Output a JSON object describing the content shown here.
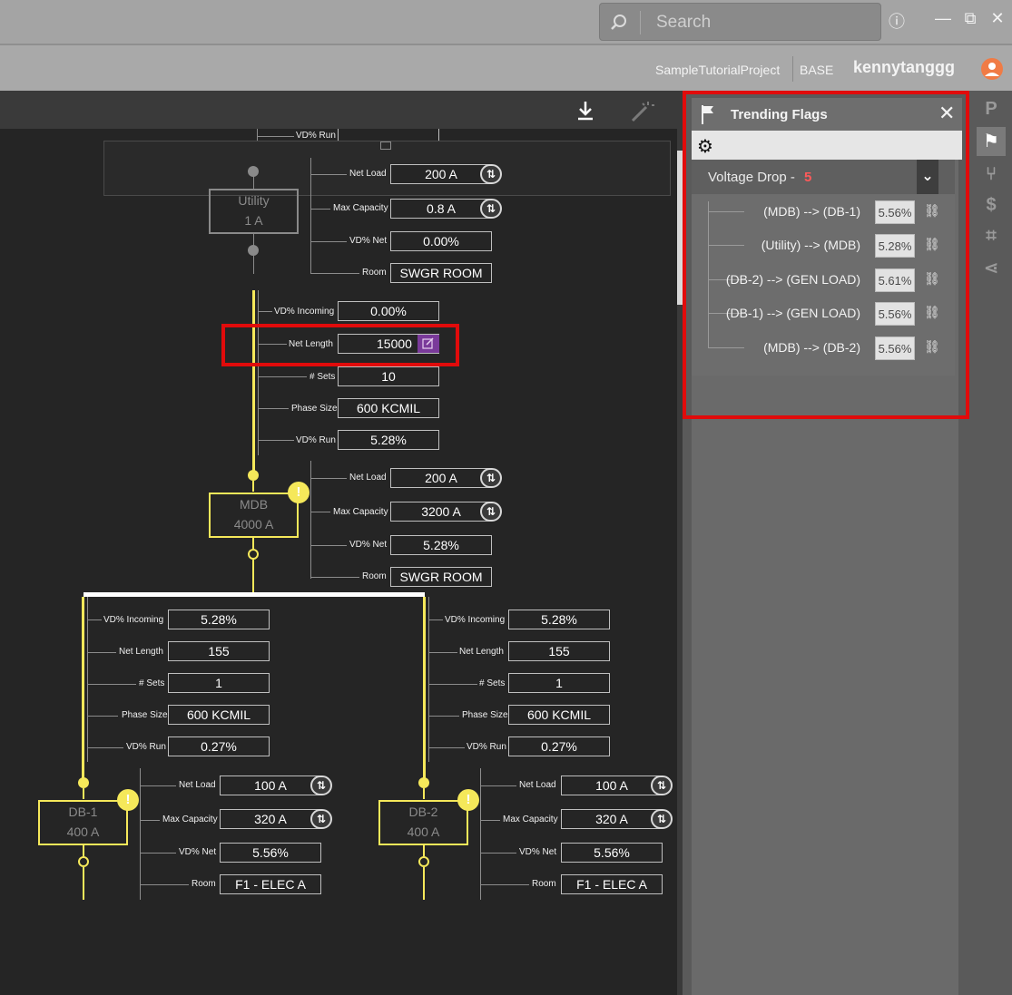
{
  "titlebar": {
    "search_placeholder": "Search",
    "info_icon": "ⓘ",
    "minimize": "—",
    "maximize": "⧉",
    "close": "✕"
  },
  "userbar": {
    "project": "SampleTutorialProject",
    "branch": "BASE",
    "username": "kennytanggg"
  },
  "canvas": {
    "top_partial": {
      "vd_run_label": "VD% Run"
    },
    "utility": {
      "name": "Utility",
      "rating": "1 A",
      "net_load_label": "Net Load",
      "net_load": "200 A",
      "max_capacity_label": "Max Capacity",
      "max_capacity": "0.8 A",
      "vd_net_label": "VD% Net",
      "vd_net": "0.00%",
      "room_label": "Room",
      "room": "SWGR ROOM"
    },
    "feeder_utility_mdb": {
      "vd_incoming_label": "VD% Incoming",
      "vd_incoming": "0.00%",
      "net_length_label": "Net Length",
      "net_length": "15000",
      "sets_label": "# Sets",
      "sets": "10",
      "phase_size_label": "Phase Size",
      "phase_size": "600 KCMIL",
      "vd_run_label": "VD% Run",
      "vd_run": "5.28%"
    },
    "mdb": {
      "name": "MDB",
      "rating": "4000 A",
      "net_load_label": "Net Load",
      "net_load": "200 A",
      "max_capacity_label": "Max Capacity",
      "max_capacity": "3200 A",
      "vd_net_label": "VD% Net",
      "vd_net": "5.28%",
      "room_label": "Room",
      "room": "SWGR ROOM"
    },
    "feeder_mdb_db1": {
      "vd_incoming_label": "VD% Incoming",
      "vd_incoming": "5.28%",
      "net_length_label": "Net Length",
      "net_length": "155",
      "sets_label": "# Sets",
      "sets": "1",
      "phase_size_label": "Phase Size",
      "phase_size": "600 KCMIL",
      "vd_run_label": "VD% Run",
      "vd_run": "0.27%"
    },
    "feeder_mdb_db2": {
      "vd_incoming_label": "VD% Incoming",
      "vd_incoming": "5.28%",
      "net_length_label": "Net Length",
      "net_length": "155",
      "sets_label": "# Sets",
      "sets": "1",
      "phase_size_label": "Phase Size",
      "phase_size": "600 KCMIL",
      "vd_run_label": "VD% Run",
      "vd_run": "0.27%"
    },
    "db1": {
      "name": "DB-1",
      "rating": "400 A",
      "net_load_label": "Net Load",
      "net_load": "100 A",
      "max_capacity_label": "Max Capacity",
      "max_capacity": "320 A",
      "vd_net_label": "VD% Net",
      "vd_net": "5.56%",
      "room_label": "Room",
      "room": "F1 - ELEC A"
    },
    "db2": {
      "name": "DB-2",
      "rating": "400 A",
      "net_load_label": "Net Load",
      "net_load": "100 A",
      "max_capacity_label": "Max Capacity",
      "max_capacity": "320 A",
      "vd_net_label": "VD% Net",
      "vd_net": "5.56%",
      "room_label": "Room",
      "room": "F1 - ELEC A"
    },
    "warning_symbol": "!"
  },
  "trending_flags": {
    "title": "Trending Flags",
    "group_label": "Voltage Drop -",
    "group_count": "5",
    "rows": [
      {
        "path": "(MDB) --> (DB-1)",
        "value": "5.56%"
      },
      {
        "path": "(Utility) --> (MDB)",
        "value": "5.28%"
      },
      {
        "path": "(DB-2) --> (GEN LOAD)",
        "value": "5.61%"
      },
      {
        "path": "(DB-1) --> (GEN LOAD)",
        "value": "5.56%"
      },
      {
        "path": "(MDB) --> (DB-2)",
        "value": "5.56%"
      }
    ]
  },
  "colors": {
    "accent_yellow": "#f5e85a",
    "highlight_red": "#e10b0b",
    "edit_purple": "#7a3a9a",
    "flag_count_red": "#ff5a5a"
  }
}
